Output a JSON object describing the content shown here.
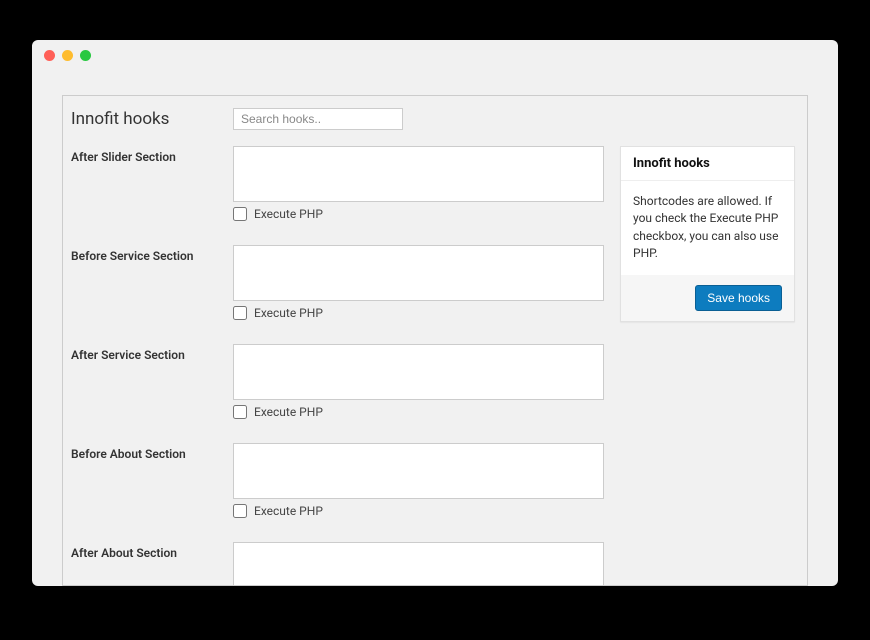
{
  "header": {
    "title": "Innofit hooks",
    "search_placeholder": "Search hooks.."
  },
  "hooks": {
    "execute_label": "Execute PHP",
    "rows": [
      {
        "label": "After Slider Section",
        "value": ""
      },
      {
        "label": "Before Service Section",
        "value": ""
      },
      {
        "label": "After Service Section",
        "value": ""
      },
      {
        "label": "Before About Section",
        "value": ""
      },
      {
        "label": "After About Section",
        "value": ""
      }
    ]
  },
  "sidebar": {
    "box_title": "Innofit hooks",
    "box_text": "Shortcodes are allowed. If you check the Execute PHP checkbox, you can also use PHP.",
    "save_label": "Save hooks"
  }
}
